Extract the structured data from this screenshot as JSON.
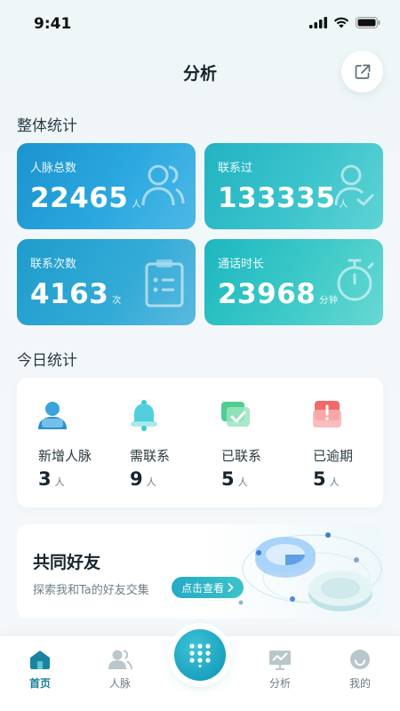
{
  "status": {
    "time": "9:41"
  },
  "header": {
    "title": "分析"
  },
  "overall": {
    "title": "整体统计",
    "cards": [
      {
        "label": "人脉总数",
        "value": "22465",
        "unit": "人",
        "icon": "people-icon"
      },
      {
        "label": "联系过",
        "value": "133335",
        "unit": "人",
        "icon": "person-check-icon"
      },
      {
        "label": "联系次数",
        "value": "4163",
        "unit": "次",
        "icon": "clipboard-icon"
      },
      {
        "label": "通话时长",
        "value": "23968",
        "unit": "分钟",
        "icon": "stopwatch-icon"
      }
    ]
  },
  "today": {
    "title": "今日统计",
    "items": [
      {
        "label": "新增人脉",
        "value": "3",
        "unit": "人",
        "icon": "new-person-icon"
      },
      {
        "label": "需联系",
        "value": "9",
        "unit": "人",
        "icon": "bell-icon"
      },
      {
        "label": "已联系",
        "value": "5",
        "unit": "人",
        "icon": "message-check-icon"
      },
      {
        "label": "已逾期",
        "value": "5",
        "unit": "人",
        "icon": "overdue-icon"
      }
    ]
  },
  "friends": {
    "title": "共同好友",
    "subtitle": "探索我和Ta的好友交集",
    "button": "点击查看"
  },
  "nav": {
    "items": [
      {
        "label": "首页",
        "icon": "home-icon"
      },
      {
        "label": "人脉",
        "icon": "contacts-icon"
      },
      {
        "label": "分析",
        "icon": "analysis-icon"
      },
      {
        "label": "我的",
        "icon": "smiley-icon"
      }
    ],
    "center_icon": "dialpad-icon"
  },
  "colors": {
    "accent": "#1a9fbf",
    "card_blue": "#2ba8df",
    "card_teal": "#3cc4cc"
  }
}
